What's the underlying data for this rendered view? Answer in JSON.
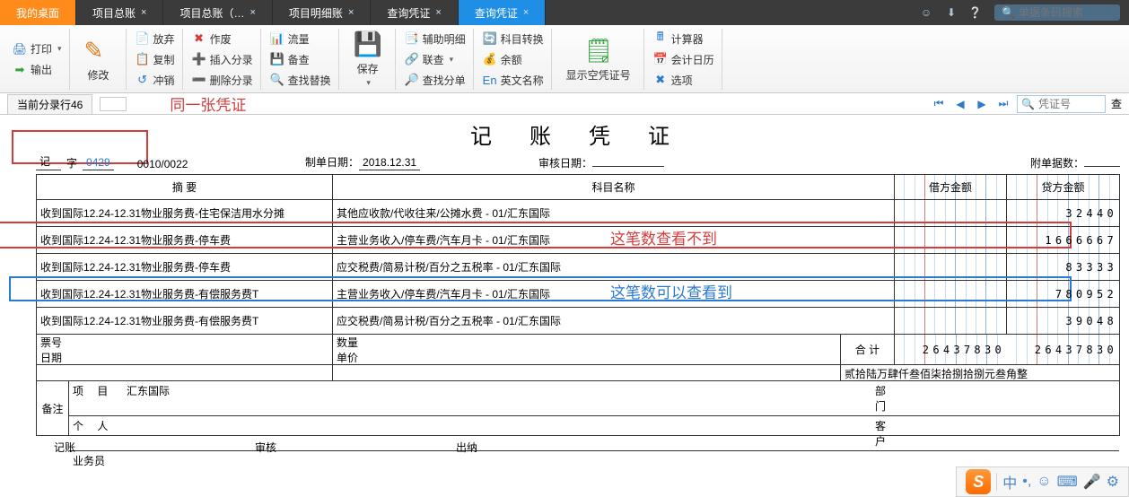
{
  "titlebar": {
    "tabs": [
      {
        "label": "我的桌面",
        "style": "orange",
        "closable": false
      },
      {
        "label": "项目总账",
        "style": "dark",
        "closable": true
      },
      {
        "label": "项目总账（…",
        "style": "dark",
        "closable": true
      },
      {
        "label": "项目明细账",
        "style": "dark",
        "closable": true
      },
      {
        "label": "查询凭证",
        "style": "dark",
        "closable": true
      },
      {
        "label": "查询凭证",
        "style": "blue",
        "closable": true
      }
    ],
    "search_placeholder": "单据条码搜索"
  },
  "ribbon": {
    "print": "打印",
    "export": "输出",
    "modify": "修改",
    "discard": "放弃",
    "copy": "复制",
    "reverse": "冲销",
    "void": "作废",
    "insert_entry": "插入分录",
    "delete_entry": "删除分录",
    "flow": "流量",
    "backup": "备查",
    "find_replace": "查找替换",
    "save": "保存",
    "aux_detail": "辅助明细",
    "contact": "联查",
    "find_entry": "查找分单",
    "subject_switch": "科目转换",
    "balance": "余额",
    "english_name": "英文名称",
    "show_empty": "显示空凭证号",
    "calculator": "计算器",
    "acct_calendar": "会计日历",
    "options": "选项"
  },
  "subbar": {
    "tab_label": "当前分录行46",
    "annotation": "同一张凭证",
    "voucher_placeholder": "凭证号",
    "search_btn": "查"
  },
  "voucher": {
    "title": "记 账 凭 证",
    "ji": "记",
    "zi": "字",
    "num": "0429",
    "seq": "0010/0022",
    "make_date_label": "制单日期：",
    "make_date": "2018.12.31",
    "audit_date_label": "审核日期：",
    "attach_label": "附单据数：",
    "headers": {
      "summary": "摘 要",
      "account": "科目名称",
      "debit": "借方金额",
      "credit": "贷方金额"
    },
    "rows": [
      {
        "summary": "收到国际12.24-12.31物业服务费-住宅保洁用水分摊",
        "account": "其他应收款/代收往来/公摊水费 - 01/汇东国际",
        "debit": "",
        "credit": "32440"
      },
      {
        "summary": "收到国际12.24-12.31物业服务费-停车费",
        "account": "主营业务收入/停车费/汽车月卡 - 01/汇东国际",
        "debit": "",
        "credit": "1666667"
      },
      {
        "summary": "收到国际12.24-12.31物业服务费-停车费",
        "account": "应交税费/简易计税/百分之五税率 - 01/汇东国际",
        "debit": "",
        "credit": "83333"
      },
      {
        "summary": "收到国际12.24-12.31物业服务费-有偿服务费T",
        "account": "主营业务收入/停车费/汽车月卡 - 01/汇东国际",
        "debit": "",
        "credit": "780952"
      },
      {
        "summary": "收到国际12.24-12.31物业服务费-有偿服务费T",
        "account": "应交税费/简易计税/百分之五税率 - 01/汇东国际",
        "debit": "",
        "credit": "39048"
      }
    ],
    "annot_red": "这笔数查看不到",
    "annot_blue": "这笔数可以查看到",
    "foot": {
      "ticket": "票号",
      "date": "日期",
      "qty": "数量",
      "price": "单价",
      "total_label": "合 计",
      "total_debit": "26437830",
      "total_credit": "26437830",
      "total_cn": "贰拾陆万肆仟叁佰柒拾捌拾捌元叁角整",
      "remark_label": "备注",
      "project": "项 目",
      "project_val": "汇东国际",
      "dept": "部 门",
      "person": "个 人",
      "customer": "客 户",
      "biz": "业务员"
    },
    "sig": {
      "jz": "记账",
      "sh": "审核",
      "cn": "出纳"
    }
  },
  "ime": {
    "zhong": "中"
  }
}
